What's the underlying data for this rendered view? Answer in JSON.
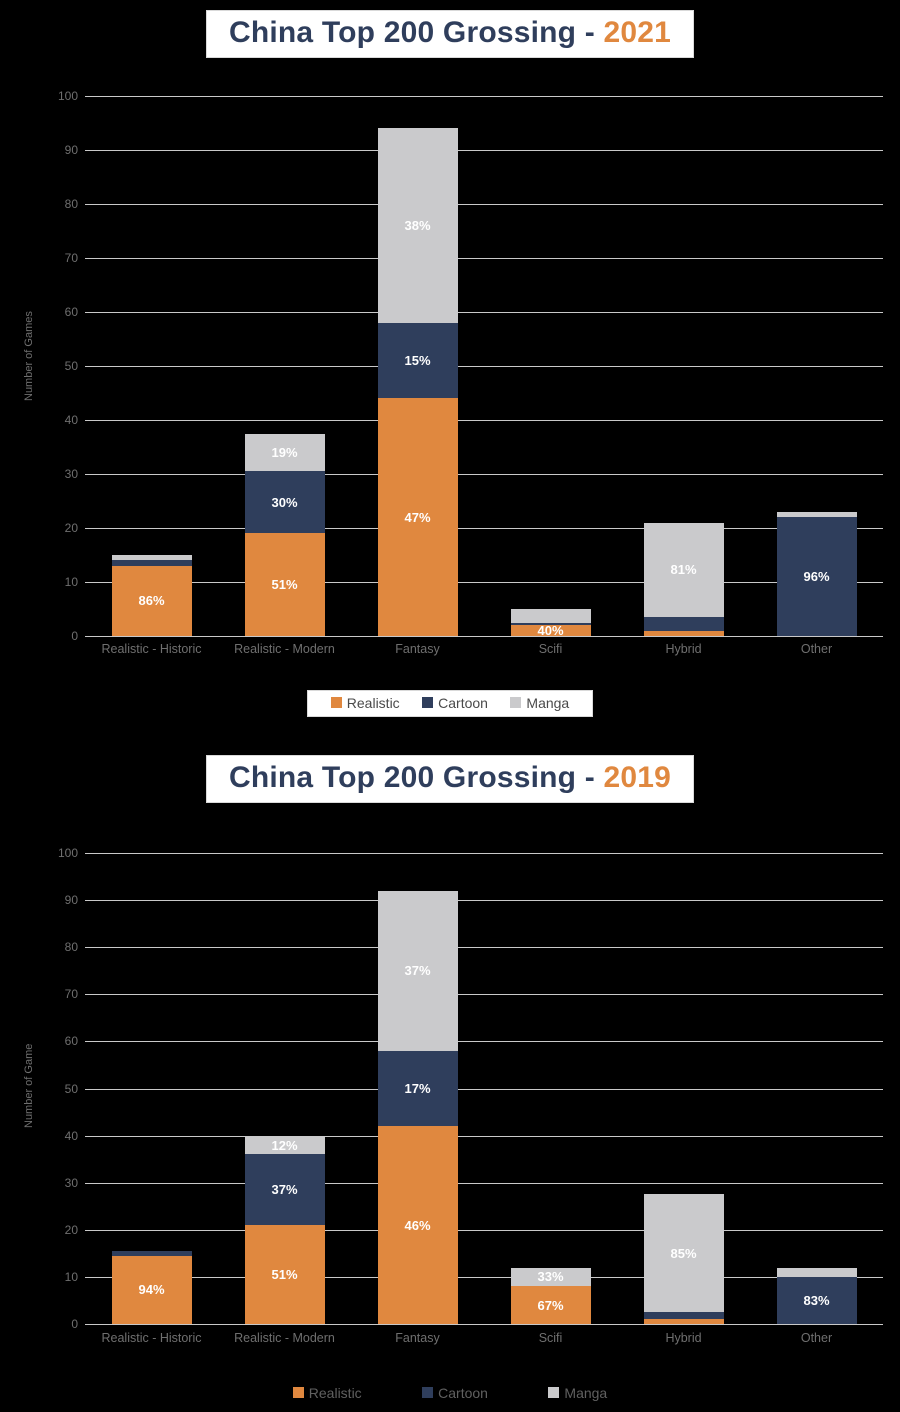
{
  "palette": {
    "realistic": "#E0883F",
    "cartoon": "#2F3E5C",
    "manga": "#CACACC",
    "background": "#000000",
    "title_text": "#2F3E5C",
    "title_year": "#E0883F",
    "gridline": "#C9C9C9",
    "tick_text": "#6F6F6F"
  },
  "charts": [
    {
      "title_main": "China Top 200 Grossing - ",
      "title_year": "2021",
      "ylabel": "Number of Games",
      "yticks": [
        "100",
        "90",
        "80",
        "70",
        "60",
        "50",
        "40",
        "30",
        "20",
        "10",
        "0"
      ],
      "legend": [
        {
          "label": "Realistic",
          "color": "#E0883F"
        },
        {
          "label": "Cartoon",
          "color": "#2F3E5C"
        },
        {
          "label": "Manga",
          "color": "#CACACC"
        }
      ],
      "chart_data": {
        "type": "bar",
        "title": "China Top 200 Grossing - 2021",
        "xlabel": "",
        "ylabel": "Number of Games",
        "ylim": [
          0,
          100
        ],
        "ytick_step": 10,
        "grid": true,
        "stacked": true,
        "legend_position": "bottom",
        "categories": [
          "Realistic - Historic",
          "Realistic - Modern",
          "Fantasy",
          "Scifi",
          "Hybrid",
          "Other"
        ],
        "series": [
          {
            "name": "Realistic",
            "color": "#E0883F",
            "values": [
              13,
              19,
              44,
              2,
              1,
              0
            ],
            "labels": [
              "86%",
              "51%",
              "47%",
              "40%",
              "",
              ""
            ]
          },
          {
            "name": "Cartoon",
            "color": "#2F3E5C",
            "values": [
              1,
              11.5,
              14,
              0.5,
              2.5,
              22
            ],
            "labels": [
              "",
              "30%",
              "15%",
              "",
              "",
              "96%"
            ]
          },
          {
            "name": "Manga",
            "color": "#CACACC",
            "values": [
              1,
              7,
              36,
              2.5,
              17.5,
              1
            ],
            "labels": [
              "",
              "19%",
              "38%",
              "",
              "81%",
              ""
            ]
          }
        ],
        "totals": [
          15,
          37.5,
          94,
          5,
          21,
          23
        ]
      }
    },
    {
      "title_main": "China Top 200 Grossing - ",
      "title_year": "2019",
      "ylabel": "Number of Game",
      "yticks": [
        "100",
        "90",
        "80",
        "70",
        "60",
        "50",
        "40",
        "30",
        "20",
        "10",
        "0"
      ],
      "legend": [
        {
          "label": "Realistic",
          "color": "#E0883F"
        },
        {
          "label": "Cartoon",
          "color": "#2F3E5C"
        },
        {
          "label": "Manga",
          "color": "#CACACC"
        }
      ],
      "chart_data": {
        "type": "bar",
        "title": "China Top 200 Grossing - 2019",
        "xlabel": "",
        "ylabel": "Number of Game",
        "ylim": [
          0,
          100
        ],
        "ytick_step": 10,
        "grid": true,
        "stacked": true,
        "legend_position": "bottom",
        "categories": [
          "Realistic - Historic",
          "Realistic - Modern",
          "Fantasy",
          "Scifi",
          "Hybrid",
          "Other"
        ],
        "series": [
          {
            "name": "Realistic",
            "color": "#E0883F",
            "values": [
              14.5,
              21,
              42,
              8,
              1,
              0
            ],
            "labels": [
              "94%",
              "51%",
              "46%",
              "67%",
              "",
              ""
            ]
          },
          {
            "name": "Cartoon",
            "color": "#2F3E5C",
            "values": [
              1,
              15,
              16,
              0,
              1.5,
              10
            ],
            "labels": [
              "",
              "37%",
              "17%",
              "",
              "",
              "83%"
            ]
          },
          {
            "name": "Manga",
            "color": "#CACACC",
            "values": [
              0,
              4,
              34,
              4,
              25,
              2
            ],
            "labels": [
              "",
              "12%",
              "37%",
              "33%",
              "85%",
              ""
            ]
          }
        ],
        "totals": [
          15.5,
          40,
          92,
          12,
          27.5,
          12
        ]
      }
    }
  ]
}
